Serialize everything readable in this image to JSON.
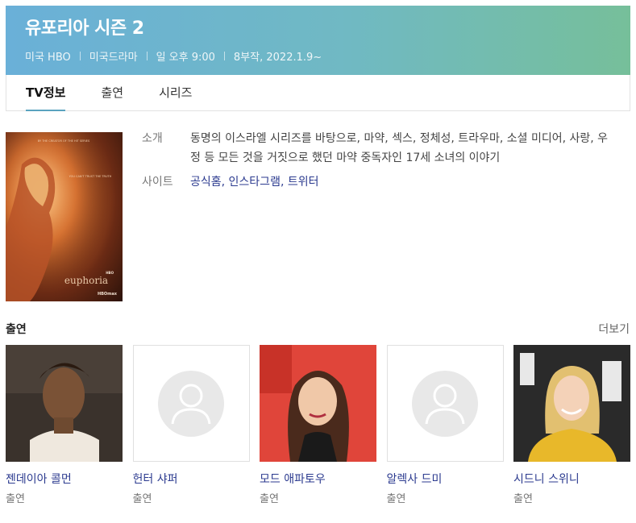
{
  "header": {
    "title": "유포리아 시즌 2",
    "meta": [
      "미국 HBO",
      "미국드라마",
      "일 오후 9:00",
      "8부작, 2022.1.9~"
    ]
  },
  "tabs": [
    {
      "label": "TV정보",
      "active": true
    },
    {
      "label": "출연",
      "active": false
    },
    {
      "label": "시리즈",
      "active": false
    }
  ],
  "poster": {
    "caption_top": "BY THE CREATOR OF THE HIT SERIES",
    "tagline": "YOU CAN'T TRUST THE TRUTH",
    "logo_text": "euphoria",
    "brand1": "HBO",
    "brand2": "HBOmax"
  },
  "info": {
    "intro_label": "소개",
    "intro_text": "동명의 이스라엘 시리즈를 바탕으로, 마약, 섹스, 정체성, 트라우마, 소셜 미디어, 사랑, 우정 등 모든 것을 거짓으로 했던 마약 중독자인 17세 소녀의 이야기",
    "site_label": "사이트",
    "sites": [
      "공식홈",
      "인스타그램",
      "트위터"
    ]
  },
  "cast": {
    "title": "출연",
    "more": "더보기",
    "members": [
      {
        "name": "젠데이아 콜먼",
        "role": "출연",
        "photo": "photo"
      },
      {
        "name": "헌터 샤퍼",
        "role": "출연",
        "photo": "placeholder"
      },
      {
        "name": "모드 애파토우",
        "role": "출연",
        "photo": "photo"
      },
      {
        "name": "알렉사 드미",
        "role": "출연",
        "photo": "placeholder"
      },
      {
        "name": "시드니 스위니",
        "role": "출연",
        "photo": "photo"
      }
    ]
  }
}
